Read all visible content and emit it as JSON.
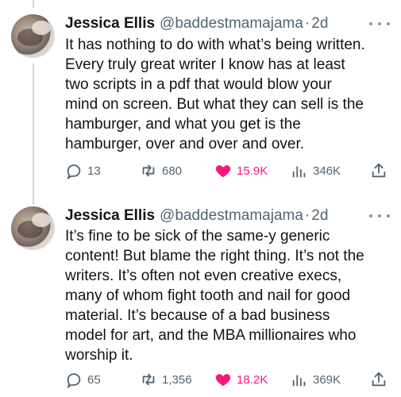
{
  "tweets": [
    {
      "author": {
        "name": "Jessica Ellis",
        "handle": "@baddestmamajama",
        "separator": "·",
        "time": "2d"
      },
      "lines": [
        "It has nothing to do with what’s being written.",
        "Every truly great writer I know has at least",
        "two scripts in a pdf that would blow your",
        "mind on screen. But what they can sell is the",
        "hamburger, and what you get is the",
        "hamburger, over and over and over."
      ],
      "stats": {
        "replies": "13",
        "retweets": "680",
        "likes": "15.9K",
        "views": "346K"
      }
    },
    {
      "author": {
        "name": "Jessica Ellis",
        "handle": "@baddestmamajama",
        "separator": "·",
        "time": "2d"
      },
      "lines": [
        "It’s fine to be sick of the same-y generic",
        "content! But blame the right thing. It’s not the",
        "writers. It’s often not even creative execs,",
        "many of whom fight tooth and nail for good",
        "material. It’s because of a bad business",
        "model for art, and the MBA millionaires who",
        "worship it."
      ],
      "stats": {
        "replies": "65",
        "retweets": "1,356",
        "likes": "18.2K",
        "views": "369K"
      }
    }
  ],
  "icons": {
    "reply": "reply-icon",
    "retweet": "retweet-icon",
    "like": "heart-icon",
    "views": "views-icon",
    "share": "share-icon",
    "more": "more-icon"
  },
  "colors": {
    "text": "#0f1419",
    "secondary": "#536471",
    "like_active": "#f91880",
    "thread_line": "#cfd9de"
  }
}
